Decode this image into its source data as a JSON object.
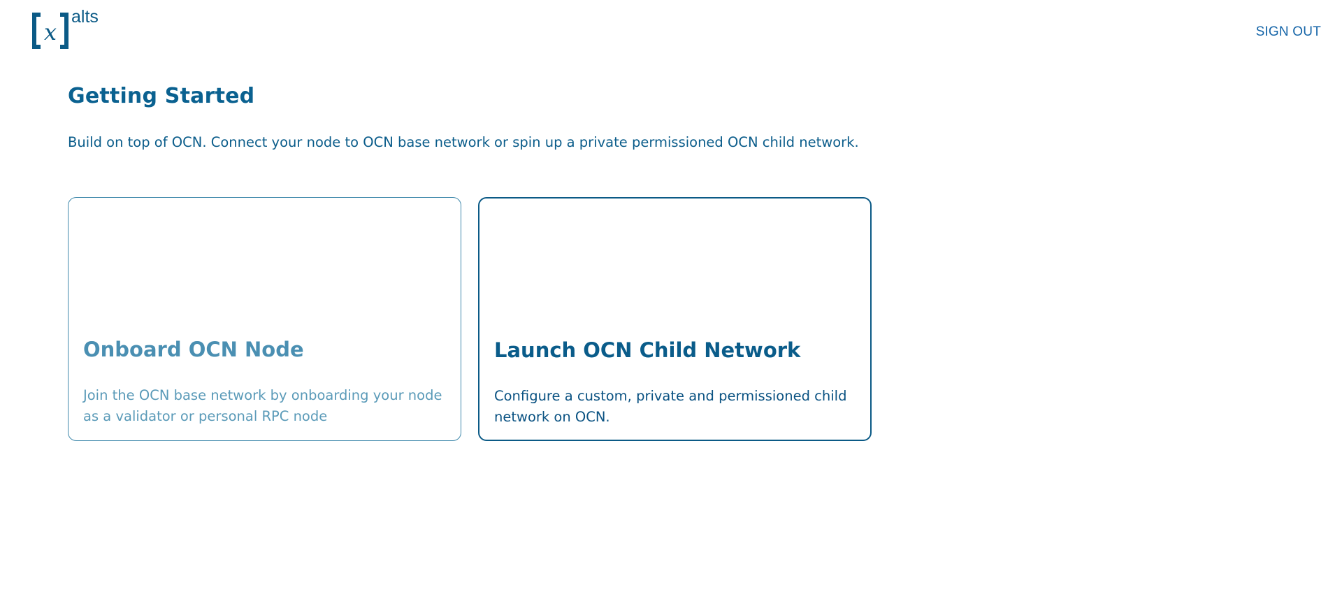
{
  "header": {
    "logo_text": "alts",
    "logo_glyph": "x",
    "signout_label": "SIGN OUT"
  },
  "main": {
    "title": "Getting Started",
    "subtitle": "Build on top of OCN. Connect your node to OCN base network or spin up a private permissioned OCN child network.",
    "cards": [
      {
        "title": "Onboard OCN Node",
        "description": "Join the OCN base network by onboarding your node as a validator or personal RPC node"
      },
      {
        "title": "Launch OCN Child Network",
        "description": "Configure a custom, private and permissioned child network on OCN."
      }
    ]
  },
  "colors": {
    "brand": "#0b5a86",
    "accent_link": "#1565a8",
    "muted_card": "#4a8fb2"
  }
}
